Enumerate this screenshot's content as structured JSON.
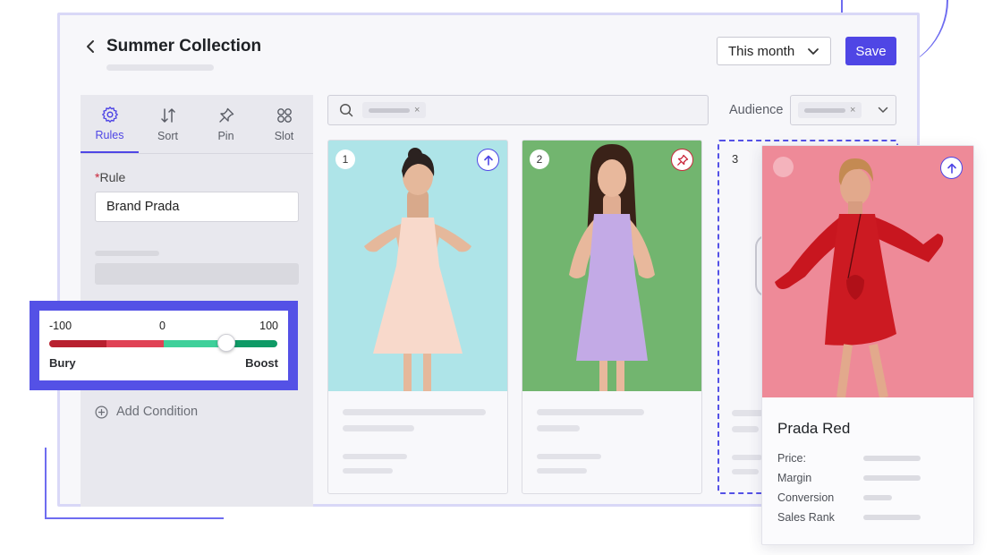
{
  "header": {
    "title": "Summer Collection",
    "date_range": "This month",
    "save_label": "Save"
  },
  "sidebar": {
    "tabs": [
      {
        "label": "Rules",
        "icon": "gear-icon",
        "active": true
      },
      {
        "label": "Sort",
        "icon": "sort-arrows-icon",
        "active": false
      },
      {
        "label": "Pin",
        "icon": "pin-icon",
        "active": false
      },
      {
        "label": "Slot",
        "icon": "slot-grid-icon",
        "active": false
      }
    ],
    "rule_label": "Rule",
    "rule_value": "Brand Prada",
    "add_condition_label": "Add Condition"
  },
  "slider": {
    "min_label": "-100",
    "mid_label": "0",
    "max_label": "100",
    "value": 55,
    "left_label": "Bury",
    "right_label": "Boost"
  },
  "toolbar": {
    "audience_label": "Audience"
  },
  "products": [
    {
      "position": "1",
      "action_icon": "boost-arrow-icon",
      "action_color": "#4f46e5"
    },
    {
      "position": "2",
      "action_icon": "pin-icon",
      "action_color": "#c9273b"
    },
    {
      "position": "3"
    }
  ],
  "popover": {
    "name": "Prada Red",
    "action_icon": "boost-arrow-icon",
    "attributes": [
      "Price:",
      "Margin",
      "Conversion",
      "Sales Rank"
    ]
  },
  "colors": {
    "accent": "#4f46e5",
    "bury": "#c9273b",
    "boost": "#1ea574"
  }
}
